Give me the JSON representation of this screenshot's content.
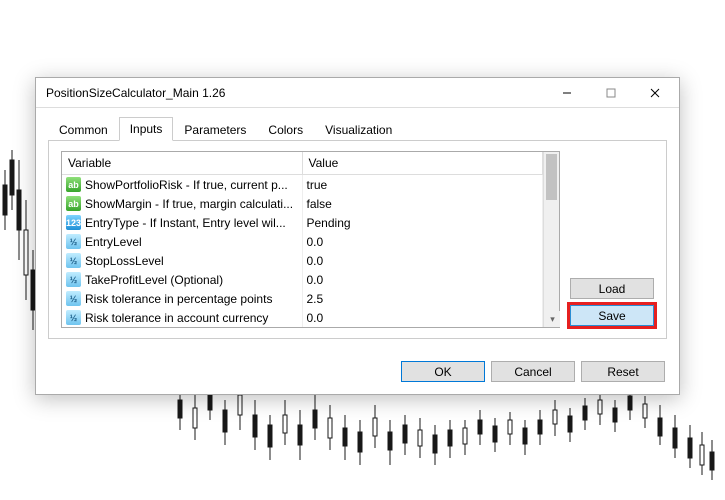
{
  "window": {
    "title": "PositionSizeCalculator_Main 1.26"
  },
  "tabs": {
    "items": [
      {
        "label": "Common"
      },
      {
        "label": "Inputs"
      },
      {
        "label": "Parameters"
      },
      {
        "label": "Colors"
      },
      {
        "label": "Visualization"
      }
    ],
    "active_index": 1
  },
  "grid": {
    "headers": {
      "variable": "Variable",
      "value": "Value"
    },
    "rows": [
      {
        "icon": "bool",
        "variable": "ShowPortfolioRisk - If true, current p...",
        "value": "true"
      },
      {
        "icon": "bool",
        "variable": "ShowMargin - If true, margin calculati...",
        "value": "false"
      },
      {
        "icon": "enum",
        "variable": "EntryType - If Instant, Entry level wil...",
        "value": "Pending"
      },
      {
        "icon": "num",
        "variable": "EntryLevel",
        "value": "0.0"
      },
      {
        "icon": "num",
        "variable": "StopLossLevel",
        "value": "0.0"
      },
      {
        "icon": "num",
        "variable": "TakeProfitLevel (Optional)",
        "value": "0.0"
      },
      {
        "icon": "num",
        "variable": "Risk tolerance in percentage points",
        "value": "2.5"
      },
      {
        "icon": "num",
        "variable": "Risk tolerance in account currency",
        "value": "0.0"
      }
    ]
  },
  "buttons": {
    "load": "Load",
    "save": "Save",
    "ok": "OK",
    "cancel": "Cancel",
    "reset": "Reset"
  },
  "icon_glyphs": {
    "bool": "ab",
    "enum": "123",
    "num": "½"
  }
}
